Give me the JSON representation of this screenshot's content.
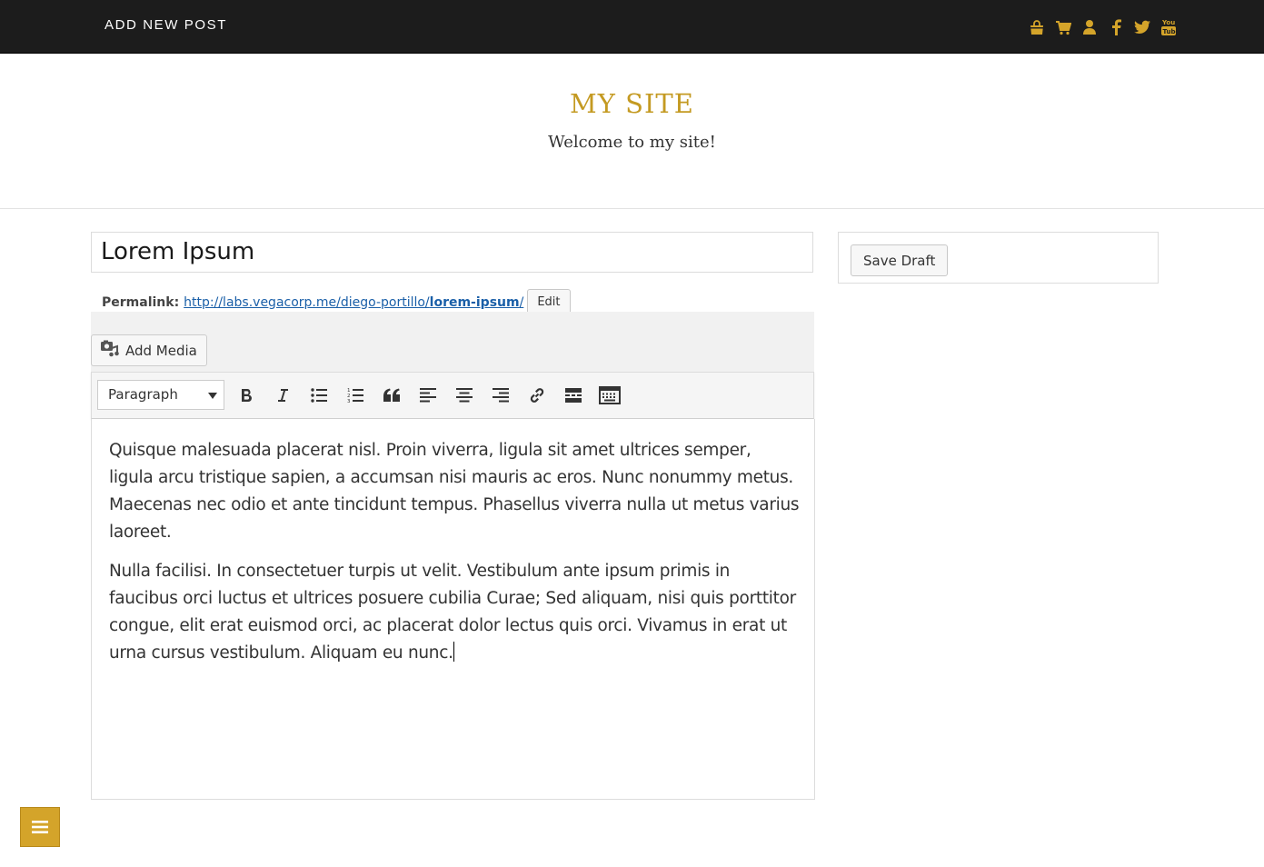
{
  "topbar": {
    "title": "ADD NEW POST",
    "icons": [
      "shopping-bag-icon",
      "cart-icon",
      "user-icon",
      "facebook-icon",
      "twitter-icon",
      "youtube-icon"
    ],
    "icon_color": "#d4a42a",
    "background": "#1c1c1c"
  },
  "header": {
    "site_title": "MY SITE",
    "tagline": "Welcome to my site!",
    "title_color": "#c49a22"
  },
  "post": {
    "title": "Lorem Ipsum",
    "permalink_label": "Permalink:",
    "permalink_base": "http://labs.vegacorp.me/diego-portillo/",
    "permalink_slug": "lorem-ipsum",
    "permalink_trailing": "/",
    "permalink_edit_label": "Edit",
    "link_color": "#1a5fa8"
  },
  "editor": {
    "add_media_label": "Add Media",
    "format_selected": "Paragraph",
    "toolbar_buttons": [
      "bold-icon",
      "italic-icon",
      "bullet-list-icon",
      "numbered-list-icon",
      "blockquote-icon",
      "align-left-icon",
      "align-center-icon",
      "align-right-icon",
      "link-icon",
      "read-more-icon",
      "toolbar-toggle-icon"
    ],
    "paragraphs": [
      "Quisque malesuada placerat nisl. Proin viverra, ligula sit amet ultrices semper, ligula arcu tristique sapien, a accumsan nisi mauris ac eros. Nunc nonummy metus. Maecenas nec odio et ante tincidunt tempus. Phasellus viverra nulla ut metus varius laoreet.",
      "Nulla facilisi. In consectetuer turpis ut velit. Vestibulum ante ipsum primis in faucibus orci luctus et ultrices posuere cubilia Curae; Sed aliquam, nisi quis porttitor congue, elit erat euismod orci, ac placerat dolor lectus quis orci. Vivamus in erat ut urna cursus vestibulum. Aliquam eu nunc."
    ]
  },
  "sidebar": {
    "save_draft_label": "Save Draft"
  },
  "fab": {
    "icon": "hamburger-menu-icon",
    "color": "#d4a42a"
  }
}
